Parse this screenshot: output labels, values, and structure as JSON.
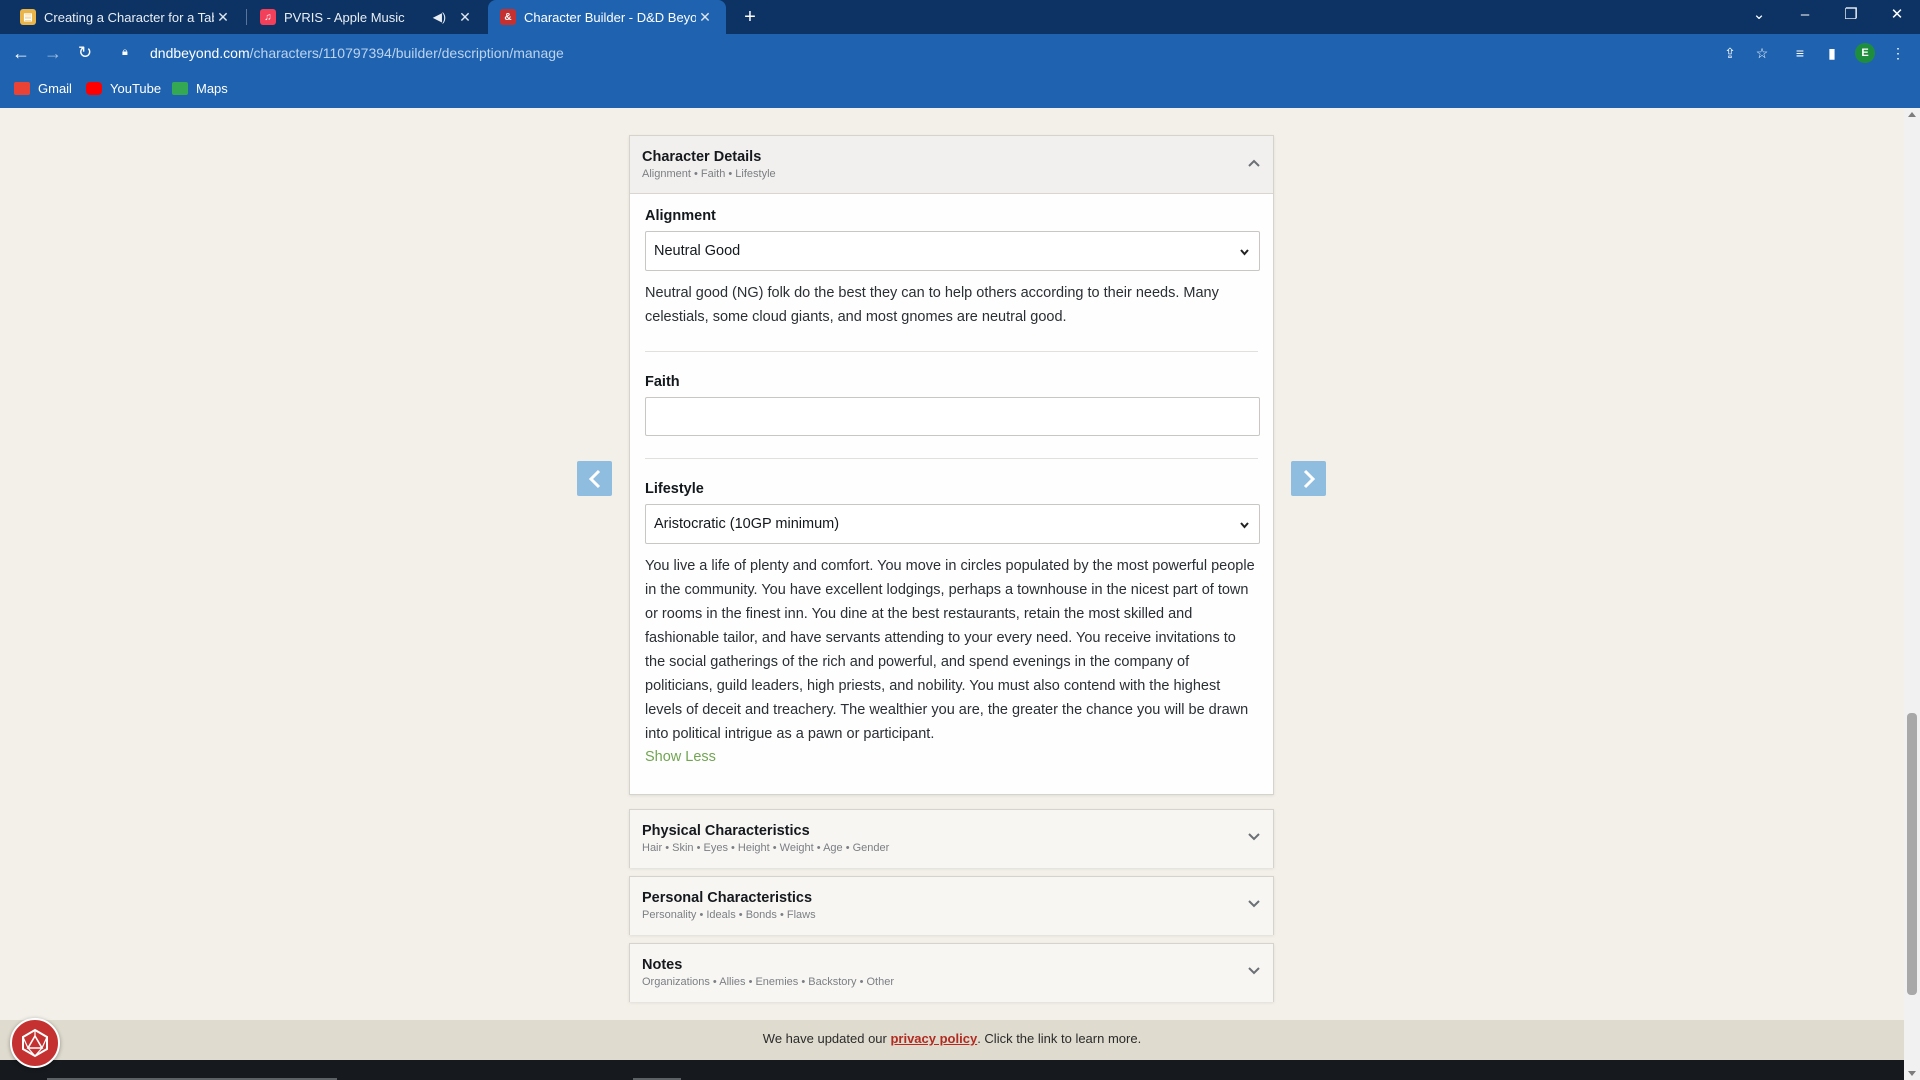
{
  "browser": {
    "tabs": [
      {
        "title": "Creating a Character for a Table",
        "favicon_color": "#e9b54a"
      },
      {
        "title": "PVRIS - Apple Music",
        "favicon_color": "#f2405a"
      },
      {
        "title": "Character Builder - D&D Beyond",
        "favicon_color": "#c53131"
      }
    ],
    "url_host": "dndbeyond.com",
    "url_path": "/characters/110797394/builder/description/manage",
    "profile_initial": "E",
    "bookmarks": [
      {
        "label": "Gmail",
        "icon_color": "#ea4335"
      },
      {
        "label": "YouTube",
        "icon_color": "#ff0000"
      },
      {
        "label": "Maps",
        "icon_color": "#34a853"
      }
    ]
  },
  "character_details": {
    "title": "Character Details",
    "subtitle": "Alignment • Faith • Lifestyle",
    "alignment_label": "Alignment",
    "alignment_value": "Neutral Good",
    "alignment_desc": "Neutral good (NG) folk do the best they can to help others according to their needs. Many celestials, some cloud giants, and most gnomes are neutral good.",
    "faith_label": "Faith",
    "faith_value": "",
    "lifestyle_label": "Lifestyle",
    "lifestyle_value": "Aristocratic (10GP minimum)",
    "lifestyle_desc": "You live a life of plenty and comfort. You move in circles populated by the most powerful people in the community. You have excellent lodgings, perhaps a townhouse in the nicest part of town or rooms in the finest inn. You dine at the best restaurants, retain the most skilled and fashionable tailor, and have servants attending to your every need. You receive invitations to the social gatherings of the rich and powerful, and spend evenings in the company of politicians, guild leaders, high priests, and nobility. You must also contend with the highest levels of deceit and treachery. The wealthier you are, the greater the chance you will be drawn into political intrigue as a pawn or participant.",
    "show_less": "Show Less"
  },
  "physical": {
    "title": "Physical Characteristics",
    "subtitle": "Hair • Skin • Eyes • Height • Weight • Age • Gender"
  },
  "personal": {
    "title": "Personal Characteristics",
    "subtitle": "Personality • Ideals • Bonds • Flaws"
  },
  "notes": {
    "title": "Notes",
    "subtitle": "Organizations • Allies • Enemies • Backstory • Other"
  },
  "privacy": {
    "prefix": "We have updated our ",
    "link": "privacy policy",
    "suffix": ". Click the link to learn more."
  },
  "colors": {
    "chrome_dark": "#0c3363",
    "chrome": "#1f63b0",
    "accent_green": "#72a552",
    "arrow_blue": "#8fbde0",
    "brand_red": "#c53131"
  }
}
